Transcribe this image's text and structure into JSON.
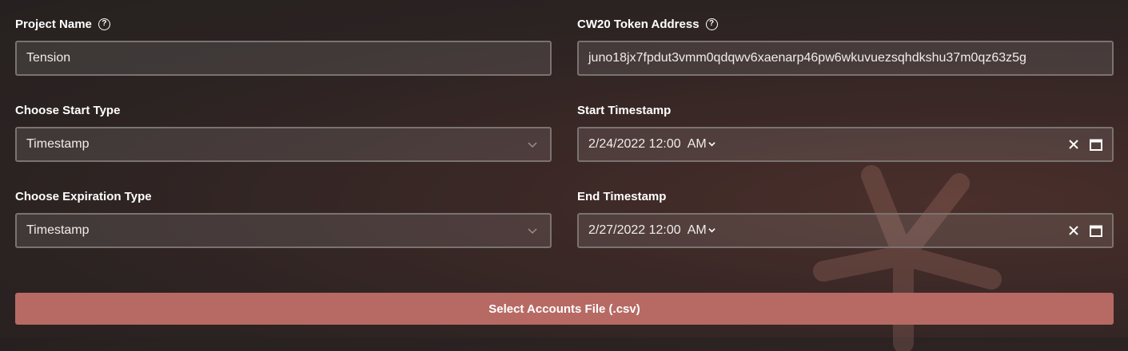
{
  "left": {
    "project_name": {
      "label": "Project Name",
      "value": "Tension",
      "icon": "help-icon"
    },
    "start_type": {
      "label": "Choose Start Type",
      "value": "Timestamp"
    },
    "expiration_type": {
      "label": "Choose Expiration Type",
      "value": "Timestamp"
    }
  },
  "right": {
    "token_address": {
      "label": "CW20 Token Address",
      "value": "juno18jx7fpdut3vmm0qdqwv6xaenarp46pw6wkuvuezsqhdkshu37m0qz63z5g",
      "icon": "help-icon"
    },
    "start_timestamp": {
      "label": "Start Timestamp",
      "date_time": "2/24/2022 12:00",
      "ampm": "AM"
    },
    "end_timestamp": {
      "label": "End Timestamp",
      "date_time": "2/27/2022 12:00",
      "ampm": "AM"
    }
  },
  "button": {
    "label": "Select Accounts File (.csv)"
  },
  "colors": {
    "accent": "#b76a64",
    "border": "#7b7370"
  }
}
